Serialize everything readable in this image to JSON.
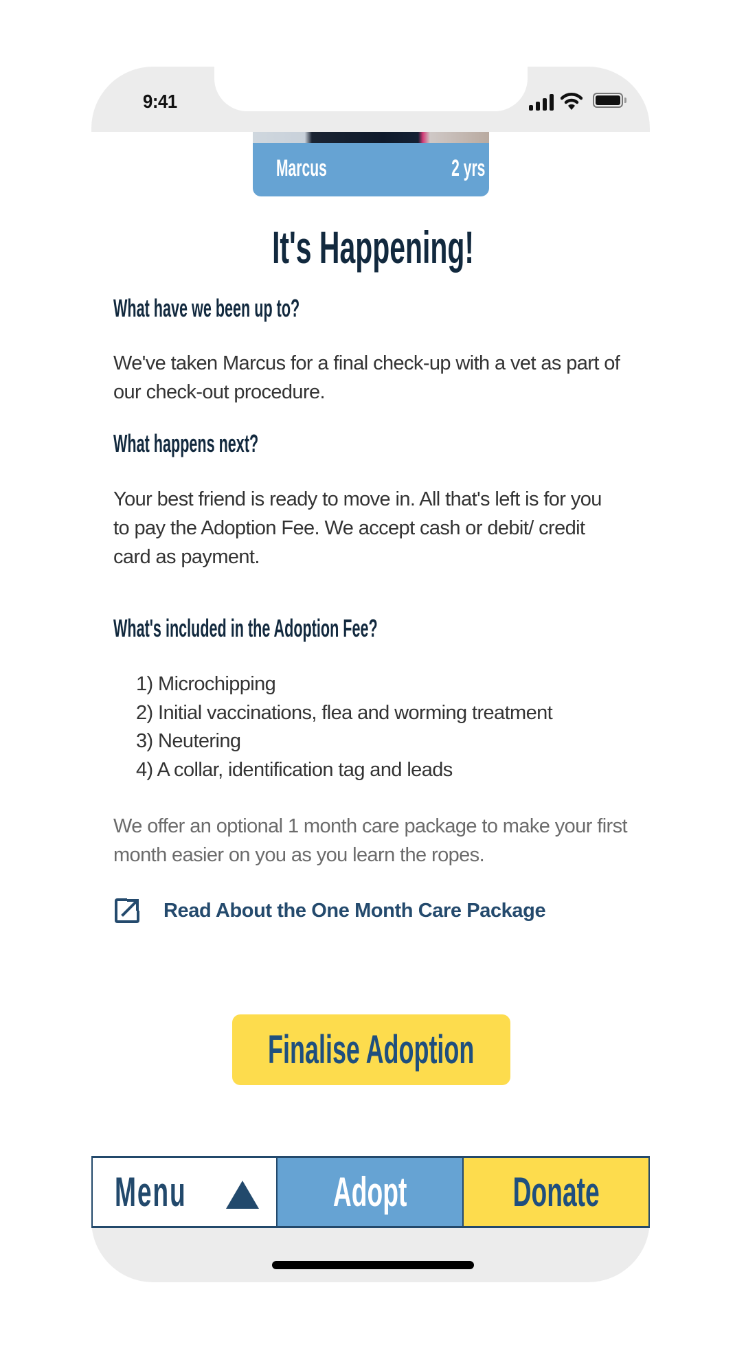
{
  "status_bar": {
    "time": "9:41",
    "icons": [
      "cellular-signal-icon",
      "wifi-icon",
      "battery-icon"
    ]
  },
  "pet_card": {
    "name": "Marcus",
    "age": "2 yrs"
  },
  "page": {
    "title": "It's Happening!",
    "sections": [
      {
        "heading": "What have we been up to?",
        "body": "We've taken Marcus for a final check-up with a vet as part of our check-out procedure."
      },
      {
        "heading": "What happens next?",
        "body": "Your best friend is ready to move in. All that's left is for you to pay the Adoption Fee. We accept cash or debit/ credit card as payment."
      },
      {
        "heading": "What's included in the Adoption Fee?",
        "items": [
          "1) Microchipping",
          "2) Initial vaccinations, flea and worming treatment",
          "3) Neutering",
          "4) A collar, identification tag and leads"
        ]
      }
    ],
    "care_package_note": "We offer an optional 1 month care package to make your first month easier on you as you learn the ropes.",
    "care_package_link": "Read About the One Month Care Package",
    "finalise_button": "Finalise Adoption"
  },
  "tab_bar": {
    "menu": "Menu",
    "adopt": "Adopt",
    "donate": "Donate"
  },
  "colors": {
    "navy": "#12293e",
    "link": "#244a6d",
    "blue": "#66a3d3",
    "yellow": "#fddc4d",
    "button_text": "#1f4f7e",
    "chrome": "#ececec"
  }
}
